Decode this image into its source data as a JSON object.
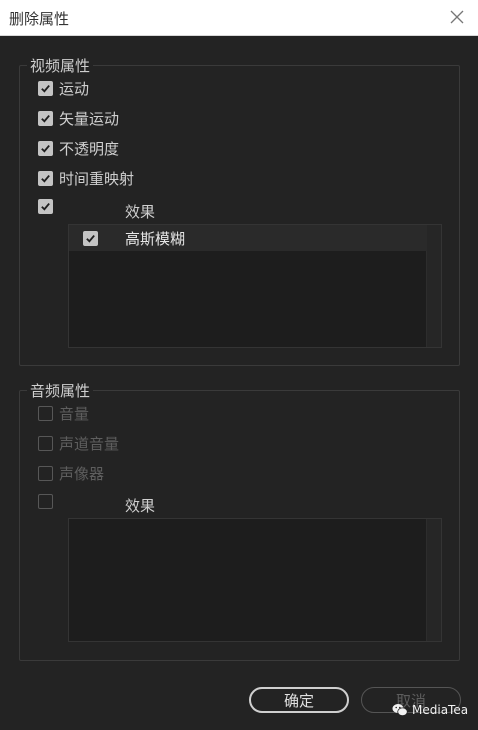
{
  "window": {
    "title": "删除属性"
  },
  "video": {
    "legend": "视频属性",
    "options": [
      {
        "label": "运动",
        "checked": true
      },
      {
        "label": "矢量运动",
        "checked": true
      },
      {
        "label": "不透明度",
        "checked": true
      },
      {
        "label": "时间重映射",
        "checked": true
      }
    ],
    "effects": {
      "label": "效果",
      "checked": true,
      "items": [
        {
          "label": "高斯模糊",
          "checked": true
        }
      ]
    }
  },
  "audio": {
    "legend": "音频属性",
    "options": [
      {
        "label": "音量",
        "checked": false
      },
      {
        "label": "声道音量",
        "checked": false
      },
      {
        "label": "声像器",
        "checked": false
      }
    ],
    "effects": {
      "label": "效果",
      "checked": false,
      "items": []
    }
  },
  "buttons": {
    "ok": "确定",
    "cancel": "取消"
  },
  "watermark": {
    "text": "MediaTea",
    "icon": "wechat-logo-icon"
  },
  "icons": {
    "close": "close-icon",
    "check": "checkmark-icon"
  }
}
